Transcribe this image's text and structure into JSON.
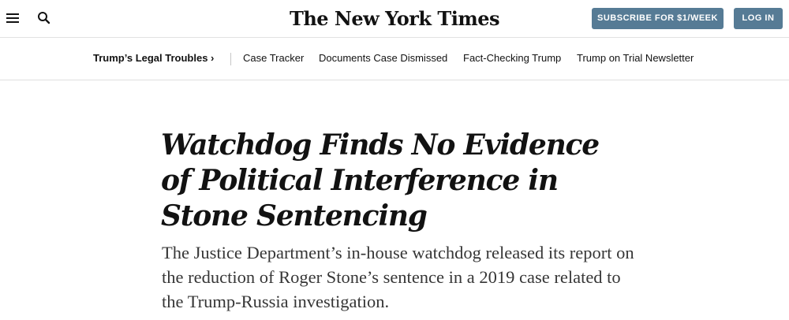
{
  "header": {
    "menu_icon": "hamburger-menu-icon",
    "search_icon": "search-icon",
    "logo_text": "The New York Times",
    "subscribe_label": "SUBSCRIBE FOR $1/WEEK",
    "login_label": "LOG IN",
    "button_color": "#567b95"
  },
  "subnav": {
    "section_label": "Trump’s Legal Troubles ›",
    "links": [
      {
        "label": "Case Tracker"
      },
      {
        "label": "Documents Case Dismissed"
      },
      {
        "label": "Fact-Checking Trump"
      },
      {
        "label": "Trump on Trial Newsletter"
      }
    ]
  },
  "article": {
    "headline": "Watchdog Finds No Evidence of Political Interference in Stone Sentencing",
    "summary": "The Justice Department’s in-house watchdog released its report on the reduction of Roger Stone’s sentence in a 2019 case related to the Trump-Russia investigation."
  }
}
